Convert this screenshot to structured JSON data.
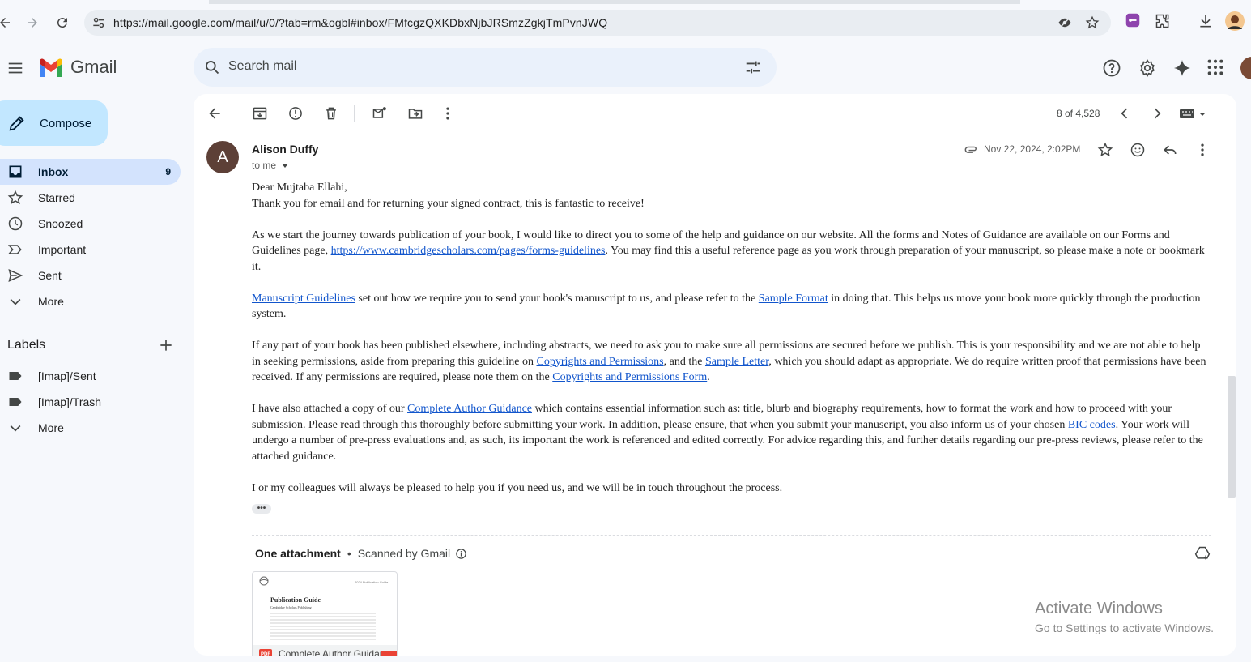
{
  "browser": {
    "url": "https://mail.google.com/mail/u/0/?tab=rm&ogbl#inbox/FMfcgzQXKDbxNjbJRSmzZgkjTmPvnJWQ"
  },
  "header": {
    "app_name": "Gmail",
    "search_placeholder": "Search mail"
  },
  "sidebar": {
    "compose_label": "Compose",
    "items": [
      {
        "label": "Inbox",
        "count": "9",
        "icon": "inbox-icon"
      },
      {
        "label": "Starred",
        "icon": "star-icon"
      },
      {
        "label": "Snoozed",
        "icon": "clock-icon"
      },
      {
        "label": "Important",
        "icon": "important-icon"
      },
      {
        "label": "Sent",
        "icon": "send-icon"
      },
      {
        "label": "More",
        "icon": "chevron-down-icon"
      }
    ],
    "labels_title": "Labels",
    "labels": [
      {
        "label": "[Imap]/Sent",
        "icon": "label-icon"
      },
      {
        "label": "[Imap]/Trash",
        "icon": "label-icon"
      },
      {
        "label": "More",
        "icon": "chevron-down-icon"
      }
    ]
  },
  "toolbar": {
    "pager": "8 of 4,528"
  },
  "message": {
    "sender_initial": "A",
    "sender_name": "Alison Duffy",
    "recipient": "to me",
    "date": "Nov 22, 2024, 2:02PM",
    "greeting": "Dear Mujtaba Ellahi,",
    "p1": "Thank you for email and for returning your signed contract, this is fantastic to receive!",
    "p2_a": "As we start the journey towards publication of your book, I would like to direct you to some of the help and guidance on our website. All the forms and Notes of Guidance are available on our Forms and Guidelines page, ",
    "p2_link": "https://www.cambridgescholars.com/pages/forms-guidelines",
    "p2_b": ". You may find this a useful reference page as you work through preparation of your manuscript, so please make a note or bookmark it.",
    "p3_link1": "Manuscript Guidelines",
    "p3_a": " set out how we require you to send your book's manuscript to us, and please refer to the ",
    "p3_link2": "Sample Format",
    "p3_b": " in doing that. This helps us move your book more quickly through the production system.",
    "p4_a": "If any part of your book has been published elsewhere, including abstracts, we need to ask you to make sure all permissions are secured before we publish. This is your responsibility and we are not able to help in seeking permissions, aside from preparing this guideline on ",
    "p4_link1": "Copyrights and Permissions",
    "p4_b": ", and the ",
    "p4_link2": "Sample Letter",
    "p4_c": ", which you should adapt as appropriate. We do require written proof that permissions have been received. If any permissions are required, please note them on the ",
    "p4_link3": "Copyrights and Permissions Form",
    "p4_d": ".",
    "p5_a": "I have also attached a copy of our ",
    "p5_link1": "Complete Author Guidance",
    "p5_b": " which contains essential information such as: title, blurb and biography requirements, how to format the work and how to proceed with your submission. Please read through this thoroughly before submitting your work. In addition, please ensure, that when you submit your manuscript, you also inform us of your chosen ",
    "p5_link2": "BIC codes",
    "p5_c": ". Your work will undergo a number of pre-press evaluations and, as such, its important the work is referenced and edited correctly. For advice regarding this, and further details regarding our pre-press reviews, please refer to the attached guidance.",
    "p6": "I or my colleagues will always be pleased to help you if you need us, and we will be in touch throughout the process.",
    "ellipsis": "•••"
  },
  "attachment": {
    "title": "One attachment",
    "dot": "•",
    "scanned": "Scanned by Gmail",
    "doc_title": "Publication Guide",
    "doc_subtitle": "Cambridge Scholars Publishing",
    "doc_header": "2024 Publication Guide",
    "badge": "PDF",
    "file_name": "Complete Author Guidance.pdf"
  },
  "watermark": {
    "line1": "Activate Windows",
    "line2": "Go to Settings to activate Windows."
  },
  "colors": {
    "accent": "#0b57d0",
    "compose_bg": "#c2e7ff",
    "active_nav_bg": "#d3e3fd",
    "link": "#1155cc"
  }
}
